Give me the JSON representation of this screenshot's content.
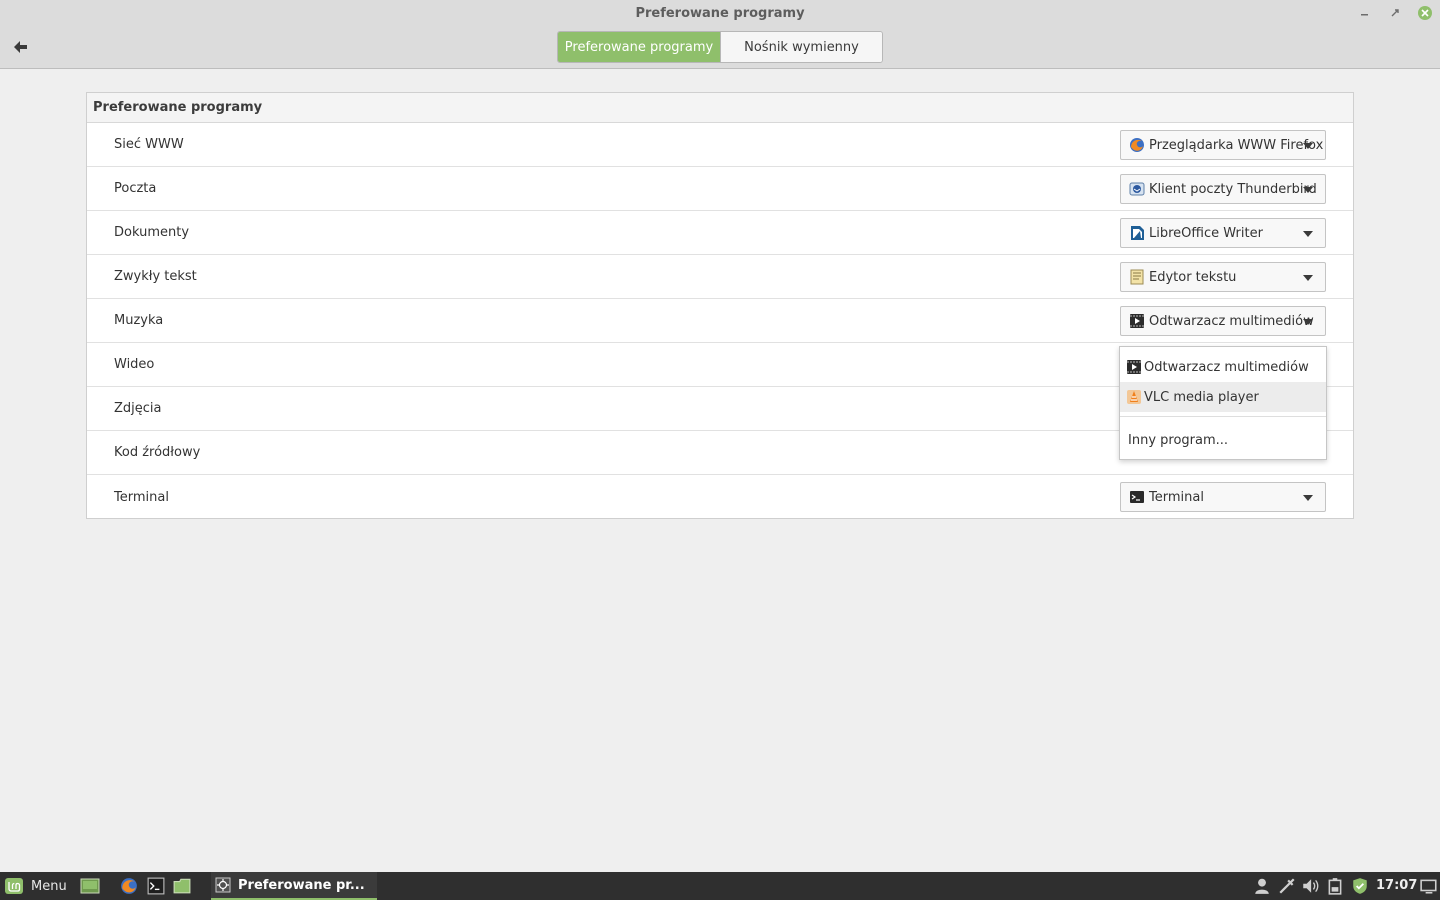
{
  "window": {
    "title": "Preferowane programy",
    "tabs": [
      {
        "label": "Preferowane programy",
        "active": true
      },
      {
        "label": "Nośnik wymienny",
        "active": false
      }
    ]
  },
  "panel": {
    "title": "Preferowane programy",
    "rows": [
      {
        "label": "Sieć WWW",
        "value": "Przeglądarka WWW Firefox",
        "icon": "firefox-icon"
      },
      {
        "label": "Poczta",
        "value": "Klient poczty Thunderbird",
        "icon": "thunderbird-icon"
      },
      {
        "label": "Dokumenty",
        "value": "LibreOffice Writer",
        "icon": "libreoffice-writer-icon"
      },
      {
        "label": "Zwykły tekst",
        "value": "Edytor tekstu",
        "icon": "text-editor-icon"
      },
      {
        "label": "Muzyka",
        "value": "Odtwarzacz multimediów",
        "icon": "media-player-icon"
      },
      {
        "label": "Wideo"
      },
      {
        "label": "Zdjęcia"
      },
      {
        "label": "Kod źródłowy"
      },
      {
        "label": "Terminal",
        "value": "Terminal",
        "icon": "terminal-icon"
      }
    ]
  },
  "dropdown": {
    "items": [
      {
        "label": "Odtwarzacz multimediów",
        "icon": "media-player-icon"
      },
      {
        "label": "VLC media player",
        "icon": "vlc-icon",
        "hovered": true
      }
    ],
    "other": "Inny program..."
  },
  "taskbar": {
    "menu_label": "Menu",
    "window_label": "Preferowane pr...",
    "clock": "17:07"
  },
  "colors": {
    "accent": "#8fbf6b",
    "taskbar": "#2f2f2f",
    "header": "#dcdcdc"
  }
}
